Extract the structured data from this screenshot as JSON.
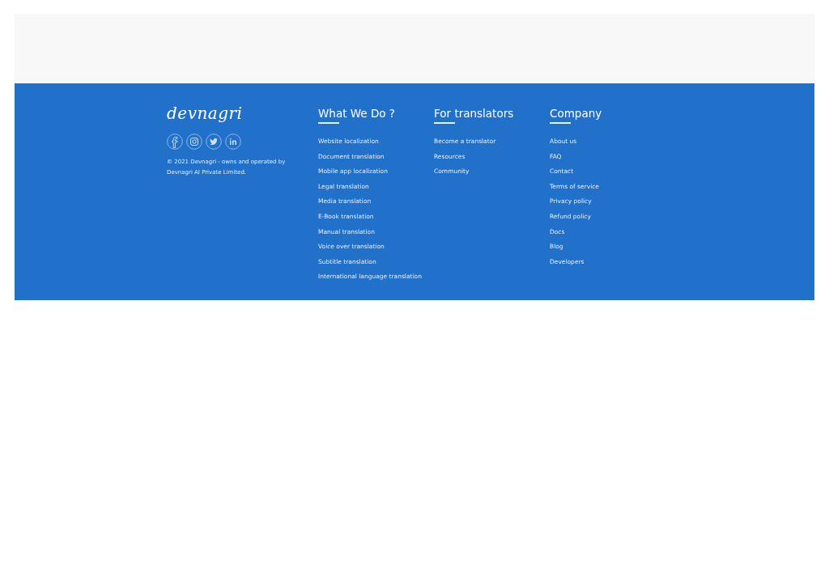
{
  "brand": {
    "logo": "devnagri",
    "copyright": "© 2021 Devnagri - owns and operated by Devnagri AI Private Limited."
  },
  "social": [
    {
      "kind": "facebook"
    },
    {
      "kind": "instagram"
    },
    {
      "kind": "twitter"
    },
    {
      "kind": "linkedin"
    }
  ],
  "columns": [
    {
      "heading": "What We Do ?",
      "links": [
        "Website localization",
        "Document translation",
        "Mobile app localization",
        "Legal translation",
        "Media translation",
        "E-Book translation",
        "Manual translation",
        "Voice over translation",
        "Subtitle translation",
        "International language translation"
      ]
    },
    {
      "heading": "For translators",
      "links": [
        "Become a translator",
        "Resources",
        "Community"
      ]
    },
    {
      "heading": "Company",
      "links": [
        "About us",
        "FAQ",
        "Contact",
        "Terms of service",
        "Privacy policy",
        "Refund policy",
        "Docs",
        "Blog",
        "Developers"
      ]
    }
  ]
}
